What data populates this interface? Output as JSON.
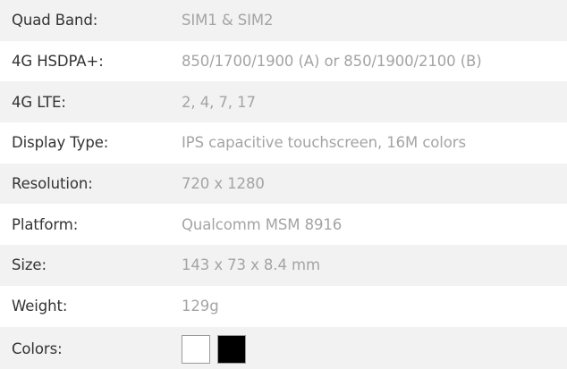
{
  "specs": [
    {
      "label": "Quad Band:",
      "value": "SIM1 & SIM2"
    },
    {
      "label": "4G HSDPA+:",
      "value": "850/1700/1900 (A) or 850/1900/2100 (B)"
    },
    {
      "label": "4G LTE:",
      "value": "2, 4, 7, 17"
    },
    {
      "label": "Display Type:",
      "value": "IPS capacitive touchscreen, 16M colors"
    },
    {
      "label": "Resolution:",
      "value": "720 x 1280"
    },
    {
      "label": "Platform:",
      "value": "Qualcomm MSM 8916"
    },
    {
      "label": "Size:",
      "value": "143 x 73 x 8.4 mm"
    },
    {
      "label": "Weight:",
      "value": "129g"
    }
  ],
  "colors": {
    "label": "Colors:",
    "swatches": [
      "#ffffff",
      "#000000"
    ]
  },
  "theme": {
    "row_shade": "#f2f2f2",
    "label_color": "#333333",
    "value_color": "#a4a4a4"
  }
}
